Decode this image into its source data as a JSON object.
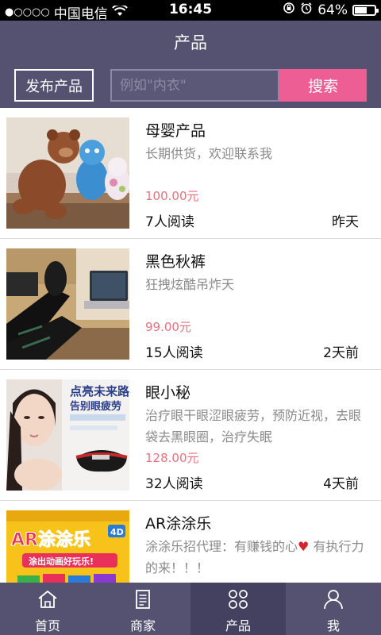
{
  "status_bar": {
    "carrier": "中国电信",
    "time": "16:45",
    "battery": "64%",
    "battery_level": 0.64
  },
  "header": {
    "title": "产品"
  },
  "search": {
    "publish_label": "发布产品",
    "placeholder": "例如\"内衣\"",
    "search_label": "搜索"
  },
  "products": [
    {
      "title": "母婴产品",
      "desc": "长期供货，欢迎联系我",
      "price": "100.00元",
      "reads": "7人阅读",
      "date": "昨天"
    },
    {
      "title": "黑色秋裤",
      "desc": "狂拽炫酷吊炸天",
      "price": "99.00元",
      "reads": "15人阅读",
      "date": "2天前"
    },
    {
      "title": "眼小秘",
      "desc": "治疗眼干眼涩眼疲劳，预防近视，去眼袋去黑眼圈，治疗失眠",
      "price": "128.00元",
      "reads": "32人阅读",
      "date": "4天前",
      "image_text_1": "点亮未来路",
      "image_text_2": "告别眼疲劳"
    },
    {
      "title": "AR涂涂乐",
      "desc_1": "涂涂乐招代理：有赚钱的心",
      "desc_2": "有执行力的来！！！",
      "image_text_1": "AR涂涂乐",
      "image_text_2": "涂出动画好玩乐!",
      "image_text_3": "4D"
    }
  ],
  "tabs": [
    {
      "label": "首页",
      "icon": "home-icon"
    },
    {
      "label": "商家",
      "icon": "document-icon"
    },
    {
      "label": "产品",
      "icon": "grid-icon",
      "active": true
    },
    {
      "label": "我",
      "icon": "user-icon"
    }
  ],
  "colors": {
    "nav_bg": "#545171",
    "accent": "#ed5f94",
    "price": "#e8727c"
  }
}
